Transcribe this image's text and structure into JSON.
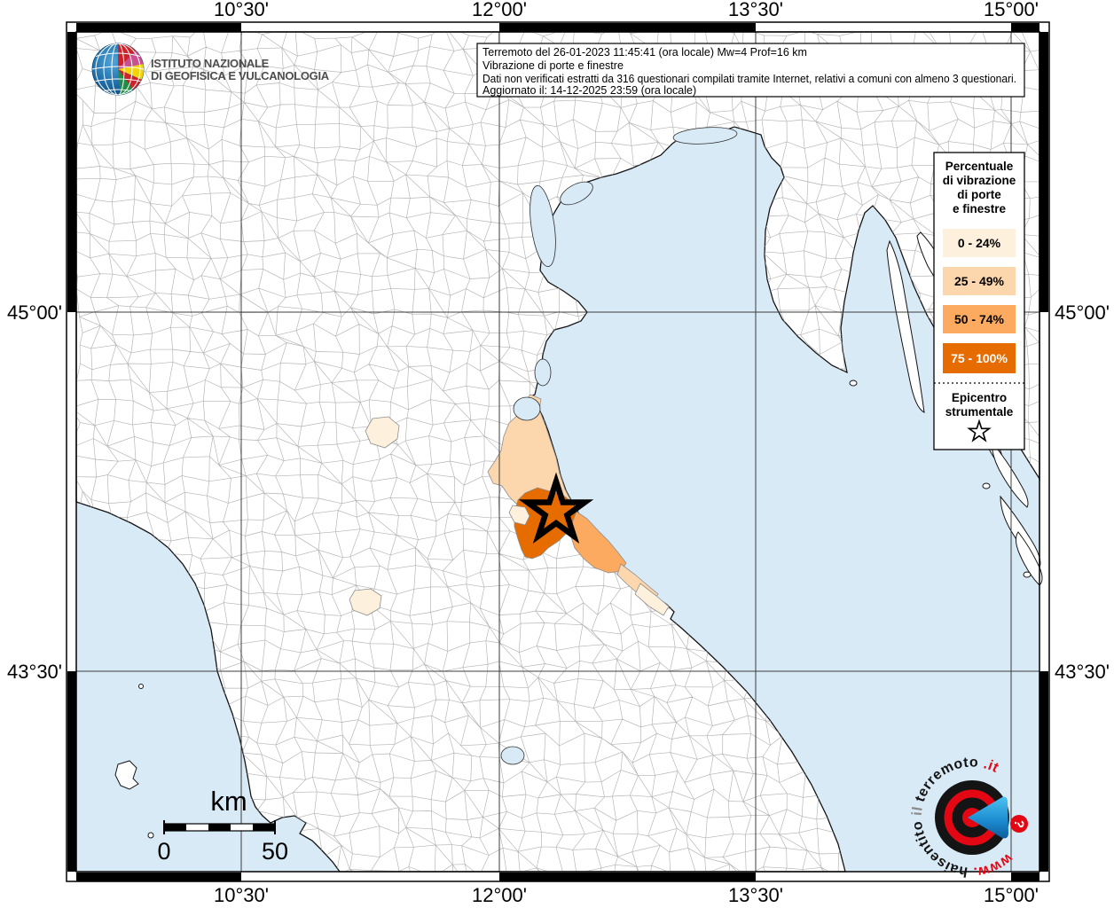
{
  "header": {
    "line1": "Terremoto del 26-01-2023 11:45:41 (ora locale) Mw=4 Prof=16 km",
    "line2": "Vibrazione di porte e finestre",
    "line3": "Dati non verificati estratti da 316 questionari compilati tramite Internet, relativi a comuni con almeno 3 questionari.",
    "line4": "Aggiornato il: 14-12-2025 23:59 (ora locale)"
  },
  "branding": {
    "ingv_line1": "ISTITUTO NAZIONALE",
    "ingv_line2": "DI GEOFISICA E VULCANOLOGIA",
    "site": {
      "www": "www.",
      "hai": "haisentito",
      "il": "il",
      "terremoto": "terremoto",
      "dotit": ".it",
      "question": "?"
    }
  },
  "legend": {
    "title_lines": [
      "Percentuale",
      "di vibrazione",
      "di porte",
      "e finestre"
    ],
    "classes": [
      {
        "label": "0 - 24%",
        "color": "#fdf0dd",
        "text_color": "#000000"
      },
      {
        "label": "25 - 49%",
        "color": "#fcd7ad",
        "text_color": "#000000"
      },
      {
        "label": "50 - 74%",
        "color": "#fbaa60",
        "text_color": "#000000"
      },
      {
        "label": "75 - 100%",
        "color": "#e66c00",
        "text_color": "#ffffff"
      }
    ],
    "epicenter_line1": "Epicentro",
    "epicenter_line2": "strumentale",
    "epicenter_symbol": "star-outline"
  },
  "axes": {
    "lon_labels": [
      "10°30'",
      "12°00'",
      "13°30'",
      "15°00'"
    ],
    "lat_labels": [
      "45°00'",
      "43°30'"
    ]
  },
  "scalebar": {
    "unit": "km",
    "start": "0",
    "end": "50"
  },
  "map": {
    "sea_color": "#d9eaf7",
    "land_color": "#ffffff",
    "grid_color": "#3c3c3c",
    "epicenter_symbol": "star"
  },
  "colors": {
    "accent_red": "#e30613",
    "logo_blue": "#2ba0dc"
  }
}
